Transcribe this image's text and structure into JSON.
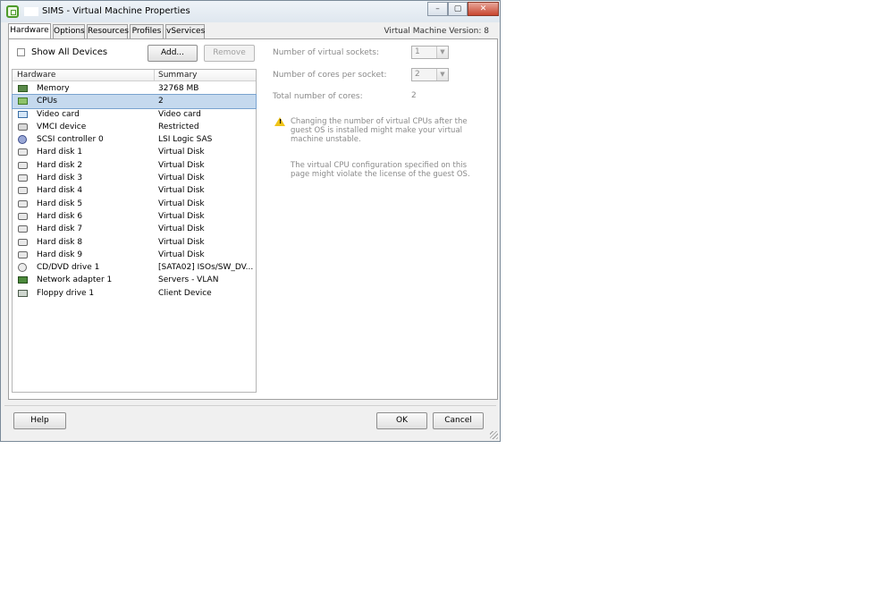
{
  "window": {
    "title": "SIMS - Virtual Machine Properties",
    "version_label": "Virtual Machine Version: 8",
    "controls": {
      "minimize": "–",
      "maximize": "▢",
      "close": "✕"
    }
  },
  "tabs": [
    {
      "label": "Hardware",
      "active": true
    },
    {
      "label": "Options",
      "active": false
    },
    {
      "label": "Resources",
      "active": false
    },
    {
      "label": "Profiles",
      "active": false
    },
    {
      "label": "vServices",
      "active": false
    }
  ],
  "hardware_panel": {
    "show_all_devices": {
      "label": "Show All Devices",
      "checked": false
    },
    "add_label": "Add...",
    "remove_label": "Remove",
    "columns": {
      "hardware": "Hardware",
      "summary": "Summary"
    },
    "rows": [
      {
        "name": "Memory",
        "summary": "32768 MB",
        "icon": "memory-icon"
      },
      {
        "name": "CPUs",
        "summary": "2",
        "icon": "cpu-icon",
        "selected": true
      },
      {
        "name": "Video card",
        "summary": "Video card",
        "icon": "video-card-icon"
      },
      {
        "name": "VMCI device",
        "summary": "Restricted",
        "icon": "vmci-device-icon"
      },
      {
        "name": "SCSI controller 0",
        "summary": "LSI Logic SAS",
        "icon": "scsi-controller-icon"
      },
      {
        "name": "Hard disk 1",
        "summary": "Virtual Disk",
        "icon": "hard-disk-icon"
      },
      {
        "name": "Hard disk 2",
        "summary": "Virtual Disk",
        "icon": "hard-disk-icon"
      },
      {
        "name": "Hard disk 3",
        "summary": "Virtual Disk",
        "icon": "hard-disk-icon"
      },
      {
        "name": "Hard disk 4",
        "summary": "Virtual Disk",
        "icon": "hard-disk-icon"
      },
      {
        "name": "Hard disk 5",
        "summary": "Virtual Disk",
        "icon": "hard-disk-icon"
      },
      {
        "name": "Hard disk 6",
        "summary": "Virtual Disk",
        "icon": "hard-disk-icon"
      },
      {
        "name": "Hard disk 7",
        "summary": "Virtual Disk",
        "icon": "hard-disk-icon"
      },
      {
        "name": "Hard disk 8",
        "summary": "Virtual Disk",
        "icon": "hard-disk-icon"
      },
      {
        "name": "Hard disk 9",
        "summary": "Virtual Disk",
        "icon": "hard-disk-icon"
      },
      {
        "name": "CD/DVD drive 1",
        "summary": "[SATA02] ISOs/SW_DV...",
        "icon": "cd-dvd-drive-icon"
      },
      {
        "name": "Network adapter 1",
        "summary": "Servers - VLAN",
        "icon": "network-adapter-icon"
      },
      {
        "name": "Floppy drive 1",
        "summary": "Client Device",
        "icon": "floppy-drive-icon"
      }
    ]
  },
  "cpu_settings": {
    "sockets_label": "Number of virtual sockets:",
    "sockets_value": "1",
    "cores_label": "Number of cores per socket:",
    "cores_value": "2",
    "total_label": "Total number of cores:",
    "total_value": "2",
    "warning_text": "Changing the number of virtual CPUs after the guest OS is installed might make your virtual machine unstable.",
    "license_note": "The virtual CPU configuration specified on this page might violate the license of the guest OS."
  },
  "footer": {
    "help_label": "Help",
    "ok_label": "OK",
    "cancel_label": "Cancel"
  }
}
